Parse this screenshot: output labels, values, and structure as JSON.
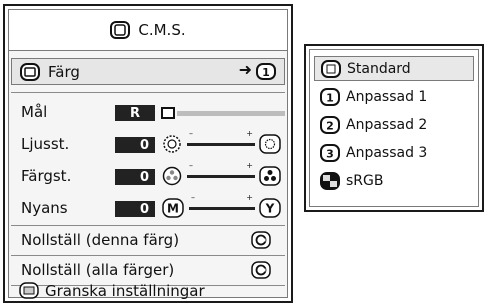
{
  "title": "C.M.S.",
  "color_row": {
    "label": "Färg",
    "value_badge": "1"
  },
  "adjustments": [
    {
      "label": "Mål",
      "value": "R",
      "icon_left": "",
      "icon_right": ""
    },
    {
      "label": "Ljusst.",
      "value": "0",
      "icon_left": "brightness-low-icon",
      "icon_right": "brightness-high-icon"
    },
    {
      "label": "Färgst.",
      "value": "0",
      "icon_left": "saturation-low-icon",
      "icon_right": "saturation-high-icon"
    },
    {
      "label": "Nyans",
      "value": "0",
      "icon_left": "M",
      "icon_right": "Y"
    }
  ],
  "actions": [
    {
      "label": "Nollställ (denna färg)"
    },
    {
      "label": "Nollställ (alla färger)"
    },
    {
      "label": "Granska inställningar"
    }
  ],
  "dropdown": {
    "options": [
      {
        "label": "Standard",
        "badge": "",
        "selected": true
      },
      {
        "label": "Anpassad 1",
        "badge": "1",
        "selected": false
      },
      {
        "label": "Anpassad 2",
        "badge": "2",
        "selected": false
      },
      {
        "label": "Anpassad 3",
        "badge": "3",
        "selected": false
      },
      {
        "label": "sRGB",
        "badge": "",
        "selected": false
      }
    ]
  }
}
